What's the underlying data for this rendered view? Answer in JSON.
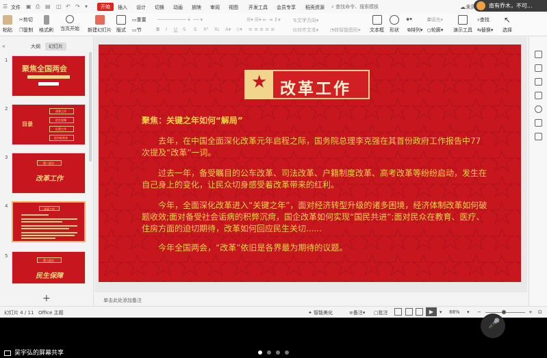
{
  "menu": {
    "file": "文件",
    "tabs": [
      "开始",
      "插入",
      "设计",
      "切换",
      "动画",
      "放映",
      "审阅",
      "视图",
      "开发工具",
      "会员专享",
      "稻壳资源"
    ],
    "active_tab": "开始",
    "search_placeholder": "查找命令、搜索模板",
    "sync_label": "未同",
    "user_name": "南有乔木，不可..."
  },
  "ribbon": {
    "paste": "粘贴",
    "cut": "剪切",
    "copy": "复制",
    "format_painter": "格式刷",
    "current_start": "当页开始",
    "new_slide": "新建幻灯片",
    "layout": "版式",
    "section": "节",
    "reset": "重置",
    "text_to_smartart": "转智能图形",
    "text_direction": "文字方向",
    "align_text": "对齐文本",
    "textbox": "文本框",
    "shape": "形状",
    "arrange": "排列",
    "outline": "轮廓",
    "fill": "填充",
    "present_tools": "演示工具",
    "find": "查找",
    "replace": "替换",
    "select": "选择"
  },
  "panel": {
    "tab_outline": "大纲",
    "tab_slides": "幻灯片",
    "slide_numbers": [
      "1",
      "2",
      "3",
      "4",
      "5"
    ],
    "thumb1_title": "聚焦全国两会",
    "thumb2_left": "目录",
    "thumb2_items": [
      "改革工作",
      "民生保障",
      "反腐工作",
      "经济新常态"
    ],
    "thumb3_label": "第一部分",
    "thumb3_title": "改革工作",
    "thumb4_label": "改革工作",
    "thumb5_label": "第二部分",
    "thumb5_title": "民生保障"
  },
  "slide": {
    "title": "改革工作",
    "subtitle": "聚焦：关键之年如何“解局”",
    "paragraphs": [
      "去年，在中国全面深化改革元年启程之际，国务院总理李克强在其首份政府工作报告中77次提及“改革”一词。",
      "过去一年，备受瞩目的公车改革、司法改革、户籍制度改革、高考改革等纷纷启动，发生在自己身上的变化，让民众切身感受着改革带来的红利。",
      "今年，全面深化改革进入“关键之年”，面对经济转型升级的诸多困境，经济体制改革如何破题收效;面对备受社会诟病的积弊沉疴，国企改革如何实现“国民共进”;面对民众在教育、医疗、住房方面的迫切期待，改革如何回应民生关切......",
      "今年全国两会，“改革”依旧是各界最为期待的议题。"
    ]
  },
  "notes_placeholder": "单击此处添加备注",
  "status": {
    "slide_index": "幻灯片 4 / 11",
    "theme": "Office 主题",
    "smart_beautify": "智能美化",
    "notes": "备注",
    "comments": "批注",
    "zoom": "88%"
  },
  "share": {
    "label": "吴宇弘的屏幕共享"
  },
  "colors": {
    "slide_bg": "#c8161e",
    "slide_text": "#f6d24a",
    "accent": "#e2231a"
  }
}
